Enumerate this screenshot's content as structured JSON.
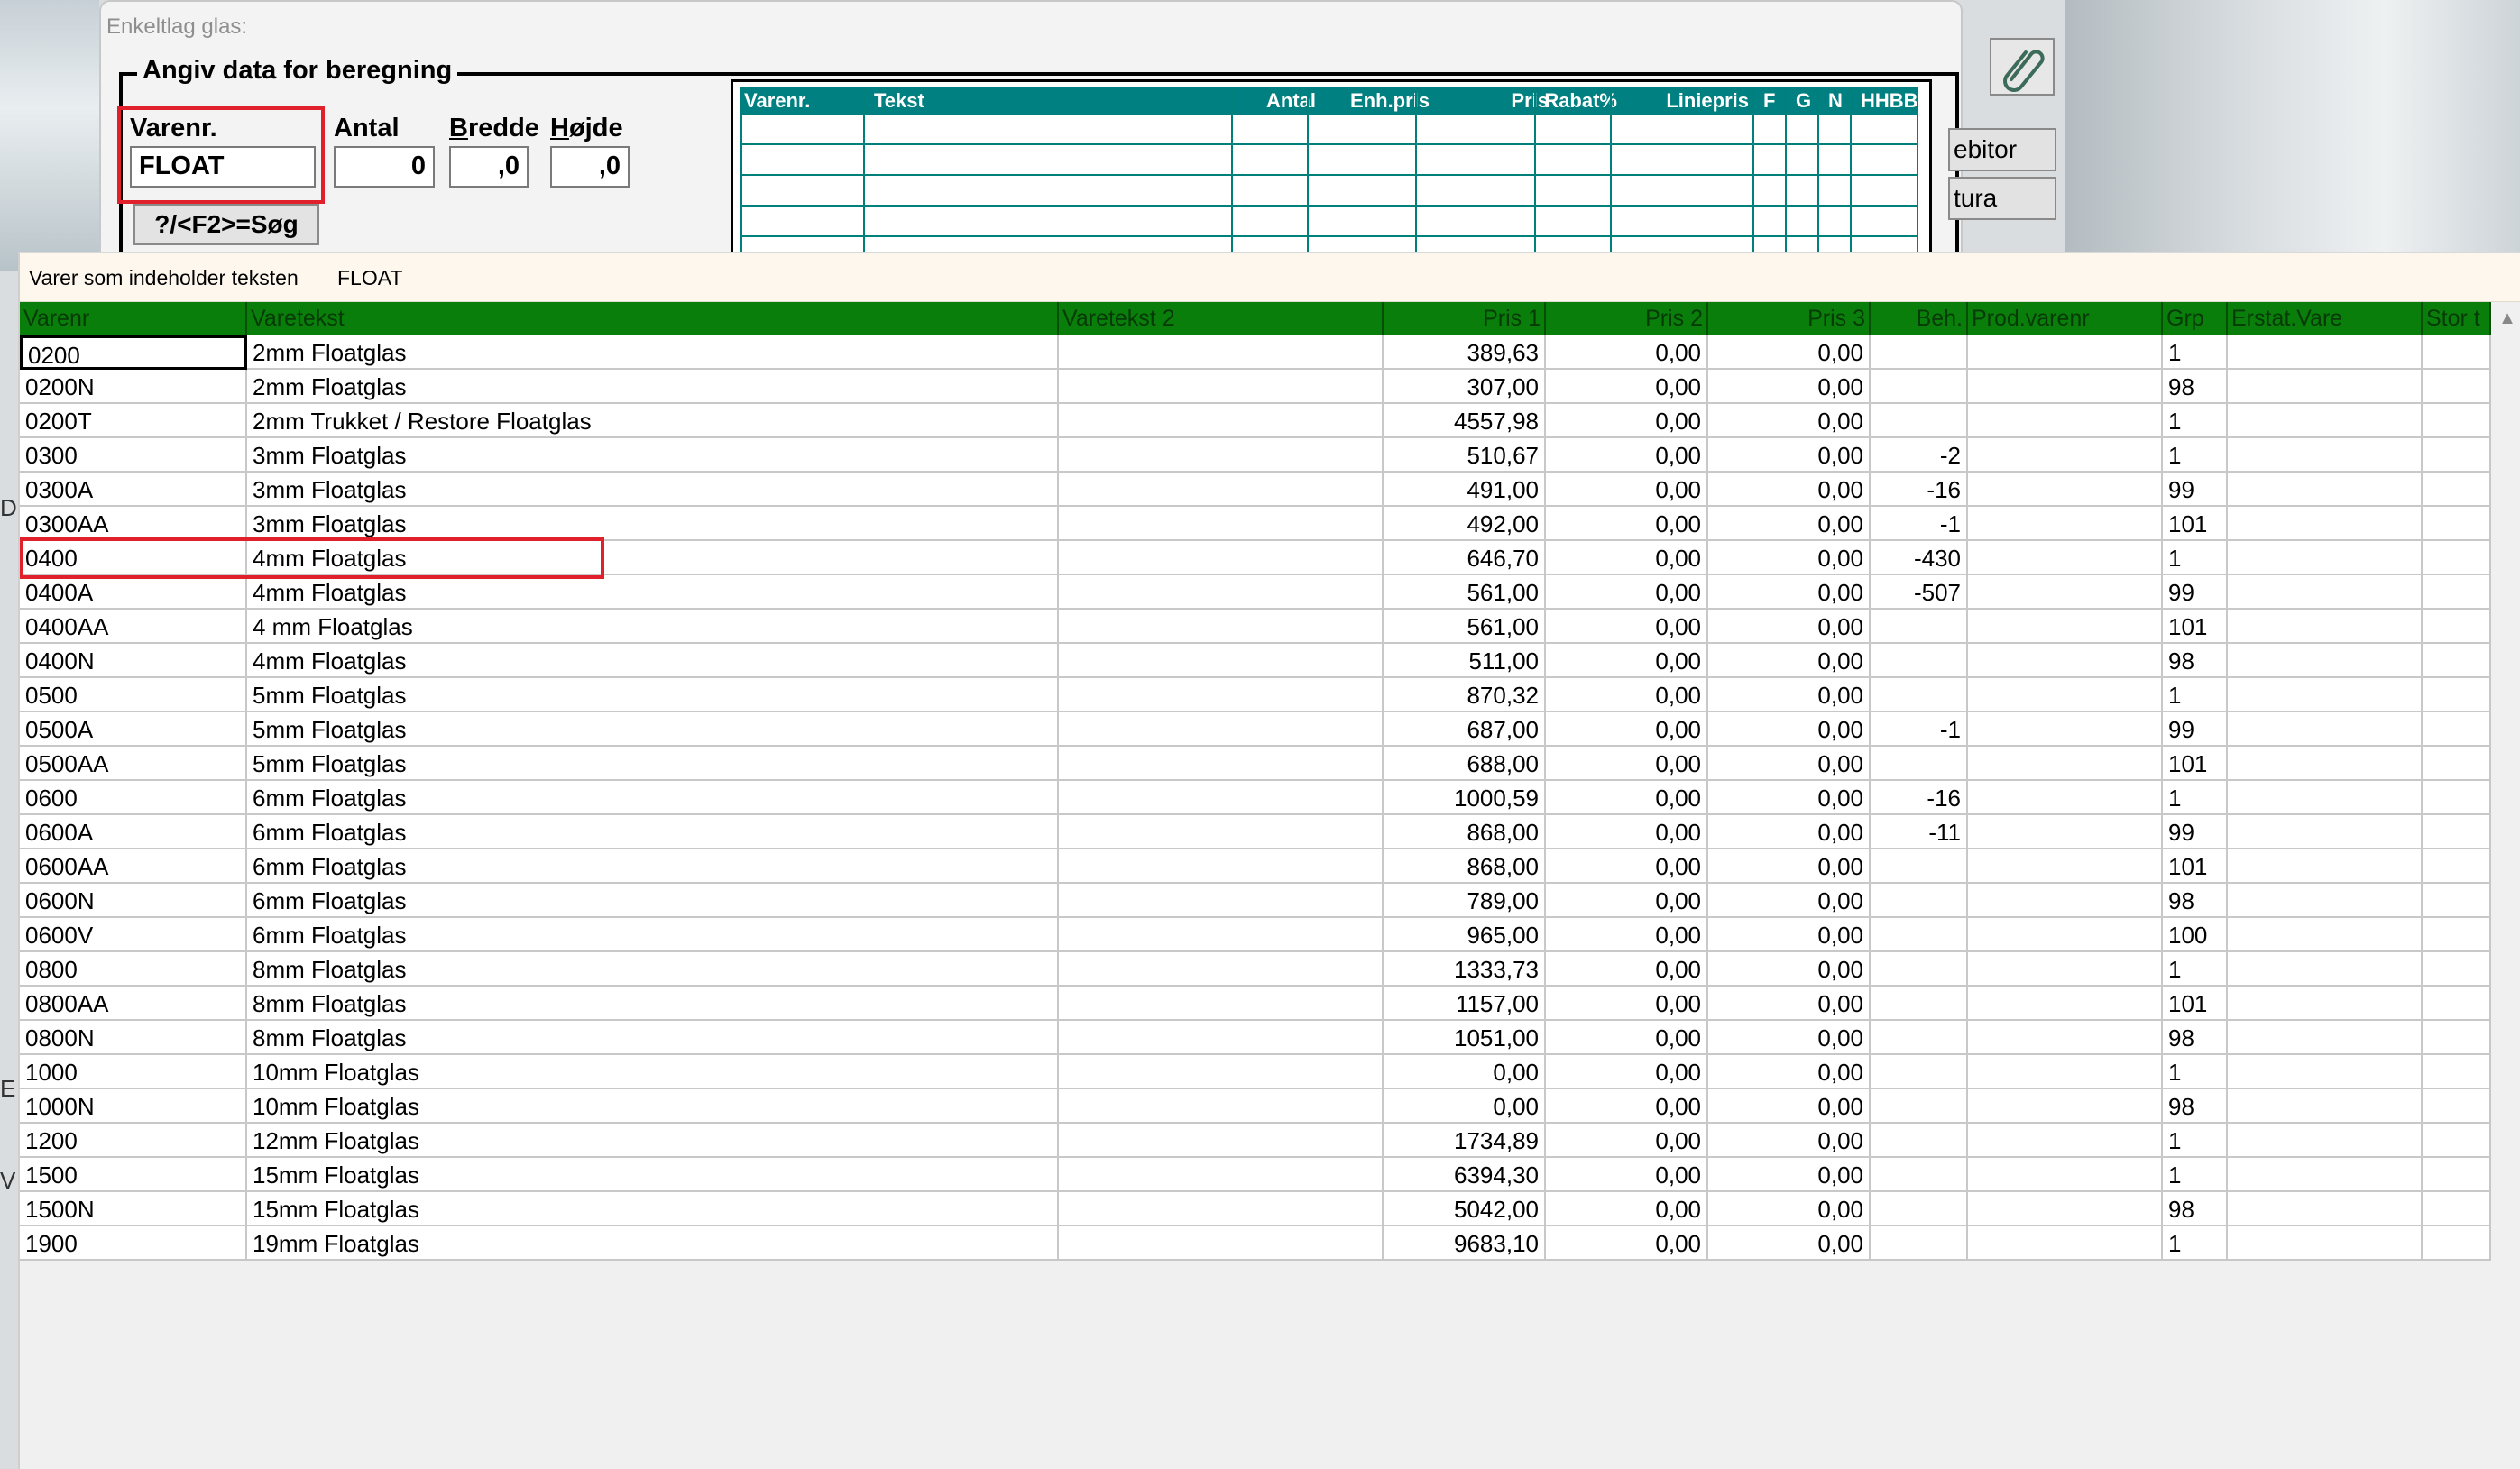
{
  "back_dialog": {
    "title": "Enkeltlag glas:",
    "group_title": "Angiv data for beregning",
    "fields": {
      "varenr": {
        "label": "Varenr.",
        "value": "FLOAT"
      },
      "antal": {
        "label": "Antal",
        "value": "0"
      },
      "bredde": {
        "label_ul": "B",
        "label_rest": "redde",
        "value": ",0"
      },
      "hojde": {
        "label_ul": "H",
        "label_rest": "øjde",
        "value": ",0"
      }
    },
    "search_button": "?/<F2>=Søg",
    "mini_table": {
      "columns": [
        "Varenr.",
        "Tekst",
        "Antal",
        "Enh.pris",
        "Pris",
        "Rabat%",
        "Liniepris",
        "F",
        "G",
        "N",
        "HHBB"
      ]
    },
    "side_buttons": [
      "ebitor",
      "tura"
    ]
  },
  "search_dialog": {
    "info_label": "Varer som indeholder teksten",
    "search_term": "FLOAT",
    "columns": [
      "Varenr",
      "Varetekst",
      "Varetekst 2",
      "Pris 1",
      "Pris 2",
      "Pris 3",
      "Beh.",
      "Prod.varenr",
      "Grp",
      "Erstat.Vare",
      "Stor t"
    ],
    "rows": [
      [
        "0200",
        "2mm Floatglas",
        "",
        "389,63",
        "0,00",
        "0,00",
        "",
        "",
        "1",
        "",
        ""
      ],
      [
        "0200N",
        "2mm Floatglas",
        "",
        "307,00",
        "0,00",
        "0,00",
        "",
        "",
        "98",
        "",
        ""
      ],
      [
        "0200T",
        "2mm Trukket / Restore Floatglas",
        "",
        "4557,98",
        "0,00",
        "0,00",
        "",
        "",
        "1",
        "",
        ""
      ],
      [
        "0300",
        "3mm Floatglas",
        "",
        "510,67",
        "0,00",
        "0,00",
        "-2",
        "",
        "1",
        "",
        ""
      ],
      [
        "0300A",
        "3mm Floatglas",
        "",
        "491,00",
        "0,00",
        "0,00",
        "-16",
        "",
        "99",
        "",
        ""
      ],
      [
        "0300AA",
        "3mm Floatglas",
        "",
        "492,00",
        "0,00",
        "0,00",
        "-1",
        "",
        "101",
        "",
        ""
      ],
      [
        "0400",
        "4mm Floatglas",
        "",
        "646,70",
        "0,00",
        "0,00",
        "-430",
        "",
        "1",
        "",
        ""
      ],
      [
        "0400A",
        "4mm Floatglas",
        "",
        "561,00",
        "0,00",
        "0,00",
        "-507",
        "",
        "99",
        "",
        ""
      ],
      [
        "0400AA",
        "4 mm Floatglas",
        "",
        "561,00",
        "0,00",
        "0,00",
        "",
        "",
        "101",
        "",
        ""
      ],
      [
        "0400N",
        "4mm Floatglas",
        "",
        "511,00",
        "0,00",
        "0,00",
        "",
        "",
        "98",
        "",
        ""
      ],
      [
        "0500",
        "5mm Floatglas",
        "",
        "870,32",
        "0,00",
        "0,00",
        "",
        "",
        "1",
        "",
        ""
      ],
      [
        "0500A",
        "5mm Floatglas",
        "",
        "687,00",
        "0,00",
        "0,00",
        "-1",
        "",
        "99",
        "",
        ""
      ],
      [
        "0500AA",
        "5mm Floatglas",
        "",
        "688,00",
        "0,00",
        "0,00",
        "",
        "",
        "101",
        "",
        ""
      ],
      [
        "0600",
        "6mm Floatglas",
        "",
        "1000,59",
        "0,00",
        "0,00",
        "-16",
        "",
        "1",
        "",
        ""
      ],
      [
        "0600A",
        "6mm Floatglas",
        "",
        "868,00",
        "0,00",
        "0,00",
        "-11",
        "",
        "99",
        "",
        ""
      ],
      [
        "0600AA",
        "6mm Floatglas",
        "",
        "868,00",
        "0,00",
        "0,00",
        "",
        "",
        "101",
        "",
        ""
      ],
      [
        "0600N",
        "6mm Floatglas",
        "",
        "789,00",
        "0,00",
        "0,00",
        "",
        "",
        "98",
        "",
        ""
      ],
      [
        "0600V",
        "6mm Floatglas",
        "",
        "965,00",
        "0,00",
        "0,00",
        "",
        "",
        "100",
        "",
        ""
      ],
      [
        "0800",
        "8mm Floatglas",
        "",
        "1333,73",
        "0,00",
        "0,00",
        "",
        "",
        "1",
        "",
        ""
      ],
      [
        "0800AA",
        "8mm Floatglas",
        "",
        "1157,00",
        "0,00",
        "0,00",
        "",
        "",
        "101",
        "",
        ""
      ],
      [
        "0800N",
        "8mm Floatglas",
        "",
        "1051,00",
        "0,00",
        "0,00",
        "",
        "",
        "98",
        "",
        ""
      ],
      [
        "1000",
        "10mm Floatglas",
        "",
        "0,00",
        "0,00",
        "0,00",
        "",
        "",
        "1",
        "",
        ""
      ],
      [
        "1000N",
        "10mm Floatglas",
        "",
        "0,00",
        "0,00",
        "0,00",
        "",
        "",
        "98",
        "",
        ""
      ],
      [
        "1200",
        "12mm Floatglas",
        "",
        "1734,89",
        "0,00",
        "0,00",
        "",
        "",
        "1",
        "",
        ""
      ],
      [
        "1500",
        "15mm Floatglas",
        "",
        "6394,30",
        "0,00",
        "0,00",
        "",
        "",
        "1",
        "",
        ""
      ],
      [
        "1500N",
        "15mm Floatglas",
        "",
        "5042,00",
        "0,00",
        "0,00",
        "",
        "",
        "98",
        "",
        ""
      ],
      [
        "1900",
        "19mm Floatglas",
        "",
        "9683,10",
        "0,00",
        "0,00",
        "",
        "",
        "1",
        "",
        ""
      ]
    ],
    "highlighted_row_index": 6,
    "focused_row_index": 0
  },
  "left_stub_glyphs": [
    "D",
    "[",
    "E",
    "V",
    "‹"
  ],
  "icons": {
    "attach": "paperclip-icon",
    "scroll_up": "chevron-up-icon"
  },
  "colors": {
    "header_bg": "#0a7e0a",
    "highlight": "#e0202a",
    "mini_header": "#008080"
  }
}
